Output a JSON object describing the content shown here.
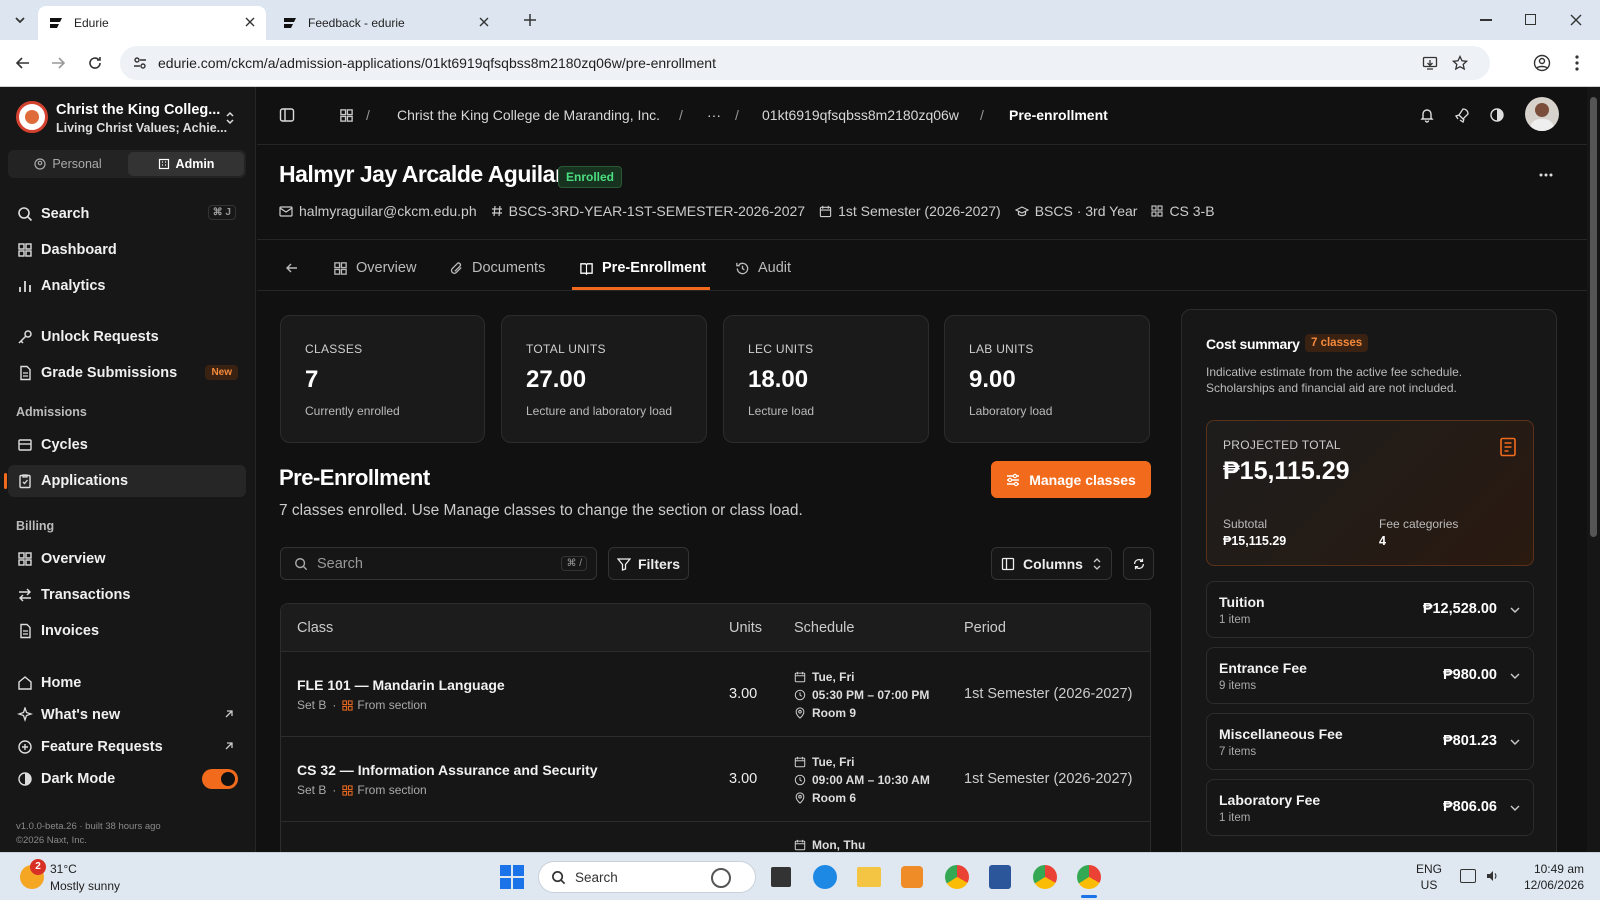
{
  "browser": {
    "tabs": [
      {
        "title": "Edurie"
      },
      {
        "title": "Feedback - edurie"
      }
    ],
    "url": "edurie.com/ckcm/a/admission-applications/01kt6919qfsqbss8m2180zq06w/pre-enrollment"
  },
  "org": {
    "name": "Christ the King Colleg...",
    "tagline": "Living Christ Values; Achie..."
  },
  "mode_toggle": {
    "personal": "Personal",
    "admin": "Admin"
  },
  "sidebar": {
    "search_label": "Search",
    "search_shortcut": "⌘ J",
    "top": [
      {
        "label": "Dashboard",
        "icon": "dashboard-icon"
      },
      {
        "label": "Analytics",
        "icon": "analytics-icon"
      }
    ],
    "work": [
      {
        "label": "Unlock Requests",
        "icon": "key-icon"
      },
      {
        "label": "Grade Submissions",
        "icon": "document-icon",
        "badge": "New"
      }
    ],
    "admissions_heading": "Admissions",
    "admissions": [
      {
        "label": "Cycles",
        "icon": "cycle-icon"
      },
      {
        "label": "Applications",
        "icon": "clipboard-icon"
      }
    ],
    "billing_heading": "Billing",
    "billing": [
      {
        "label": "Overview",
        "icon": "grid-icon"
      },
      {
        "label": "Transactions",
        "icon": "transfer-icon"
      },
      {
        "label": "Invoices",
        "icon": "invoice-icon"
      }
    ],
    "bottom": [
      {
        "label": "Home",
        "icon": "home-icon"
      },
      {
        "label": "What's new",
        "icon": "sparkle-icon"
      },
      {
        "label": "Feature Requests",
        "icon": "plus-circle-icon"
      },
      {
        "label": "Dark Mode",
        "icon": "contrast-icon"
      }
    ],
    "dark_mode_on": true,
    "version": "v1.0.0-beta.26 · built 38 hours ago",
    "copyright": "©2026 Naxt, Inc."
  },
  "breadcrumb": {
    "items": [
      "Christ the King College de Maranding, Inc.",
      "···",
      "01kt6919qfsqbss8m2180zq06w",
      "Pre-enrollment"
    ]
  },
  "student": {
    "name": "Halmyr Jay Arcalde Aguilar",
    "status": "Enrolled",
    "email": "halmyraguilar@ckcm.edu.ph",
    "code": "BSCS-3RD-YEAR-1ST-SEMESTER-2026-2027",
    "term": "1st Semester (2026-2027)",
    "program": "BSCS · 3rd Year",
    "section": "CS 3-B"
  },
  "tabs": [
    {
      "label": "Overview",
      "icon": "grid-icon"
    },
    {
      "label": "Documents",
      "icon": "paperclip-icon"
    },
    {
      "label": "Pre-Enrollment",
      "icon": "book-icon",
      "active": true
    },
    {
      "label": "Audit",
      "icon": "history-icon"
    }
  ],
  "stats": [
    {
      "label": "CLASSES",
      "value": "7",
      "sub": "Currently enrolled"
    },
    {
      "label": "TOTAL UNITS",
      "value": "27.00",
      "sub": "Lecture and laboratory load"
    },
    {
      "label": "LEC UNITS",
      "value": "18.00",
      "sub": "Lecture load"
    },
    {
      "label": "LAB UNITS",
      "value": "9.00",
      "sub": "Laboratory load"
    }
  ],
  "preenrollment": {
    "title": "Pre-Enrollment",
    "subtitle": "7 classes enrolled. Use Manage classes to change the section or class load.",
    "manage_button": "Manage classes",
    "search_placeholder": "Search",
    "search_shortcut": "⌘ /",
    "filters_button": "Filters",
    "columns_button": "Columns"
  },
  "table": {
    "headers": [
      "Class",
      "Units",
      "Schedule",
      "Period"
    ],
    "rows": [
      {
        "title": "FLE 101 — Mandarin Language",
        "set": "Set B",
        "source": "From section",
        "units": "3.00",
        "days": "Tue, Fri",
        "time": "05:30 PM – 07:00 PM",
        "room": "Room 9",
        "period": "1st Semester (2026-2027)"
      },
      {
        "title": "CS 32 — Information Assurance and Security",
        "set": "Set B",
        "source": "From section",
        "units": "3.00",
        "days": "Tue, Fri",
        "time": "09:00 AM – 10:30 AM",
        "room": "Room 6",
        "period": "1st Semester (2026-2027)"
      },
      {
        "title": "",
        "set": "",
        "source": "",
        "units": "",
        "days": "Mon, Thu",
        "time": "",
        "room": "",
        "period": ""
      }
    ]
  },
  "cost_summary": {
    "title": "Cost summary",
    "badge": "7 classes",
    "note": "Indicative estimate from the active fee schedule. Scholarships and financial aid are not included.",
    "projected_label": "PROJECTED TOTAL",
    "projected_total": "₱15,115.29",
    "subtotal_label": "Subtotal",
    "subtotal": "₱15,115.29",
    "categories_label": "Fee categories",
    "categories": "4",
    "fees": [
      {
        "name": "Tuition",
        "count": "1 item",
        "amount": "₱12,528.00"
      },
      {
        "name": "Entrance Fee",
        "count": "9 items",
        "amount": "₱980.00"
      },
      {
        "name": "Miscellaneous Fee",
        "count": "7 items",
        "amount": "₱801.23"
      },
      {
        "name": "Laboratory Fee",
        "count": "1 item",
        "amount": "₱806.06"
      }
    ]
  },
  "taskbar": {
    "weather_temp": "31°C",
    "weather_desc": "Mostly sunny",
    "weather_badge": "2",
    "search": "Search",
    "lang": "ENG",
    "region": "US",
    "time": "10:49 am",
    "date": "12/06/2026"
  },
  "colors": {
    "accent": "#f26b1d",
    "enrolled_green": "#4ade80",
    "bg": "#111111"
  }
}
